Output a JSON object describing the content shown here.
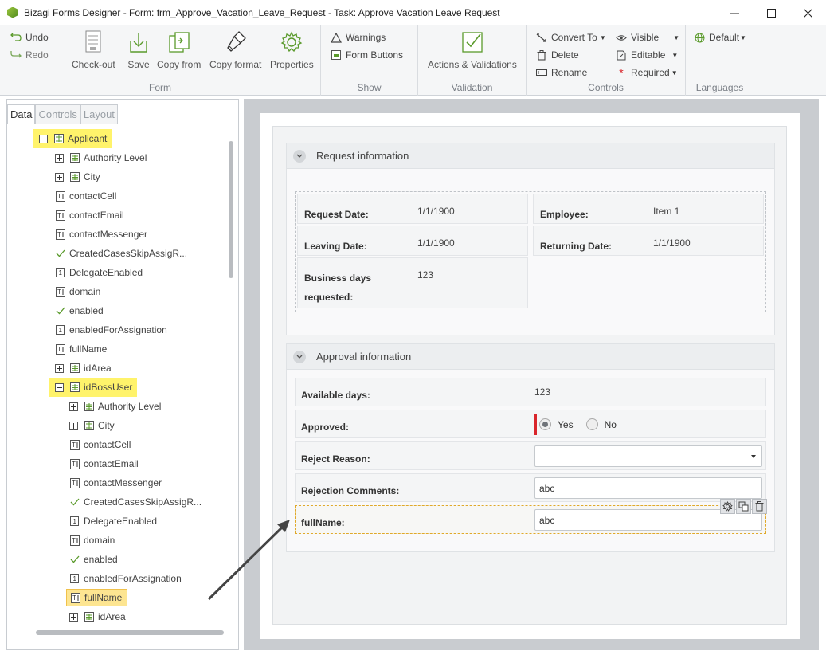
{
  "window": {
    "title": "Bizagi Forms Designer  - Form: frm_Approve_Vacation_Leave_Request - Task:  Approve Vacation Leave Request"
  },
  "ribbon": {
    "undo": "Undo",
    "redo": "Redo",
    "form": {
      "label": "Form",
      "checkout": "Check-out",
      "save": "Save",
      "copy_from": "Copy from",
      "copy_format": "Copy format",
      "properties": "Properties"
    },
    "show": {
      "label": "Show",
      "warnings": "Warnings",
      "form_buttons": "Form Buttons"
    },
    "validation": {
      "label": "Validation",
      "actions": "Actions & Validations"
    },
    "controls": {
      "label": "Controls",
      "convert_to": "Convert To",
      "delete": "Delete",
      "rename": "Rename",
      "visible": "Visible",
      "editable": "Editable",
      "required": "Required"
    },
    "languages": {
      "label": "Languages",
      "default": "Default"
    }
  },
  "left_panel": {
    "tabs": [
      "Data",
      "Controls",
      "Layout"
    ],
    "tree": [
      {
        "label": "Applicant",
        "icon": "entity-icon",
        "expander": "minus",
        "highlight": true
      },
      {
        "label": "Authority Level",
        "icon": "entity-icon",
        "expander": "plus"
      },
      {
        "label": "City",
        "icon": "entity-icon",
        "expander": "plus"
      },
      {
        "label": "contactCell",
        "icon": "text-attr-icon"
      },
      {
        "label": "contactEmail",
        "icon": "text-attr-icon"
      },
      {
        "label": "contactMessenger",
        "icon": "text-attr-icon"
      },
      {
        "label": "CreatedCasesSkipAssigR...",
        "icon": "check-icon"
      },
      {
        "label": "DelegateEnabled",
        "icon": "number-attr-icon"
      },
      {
        "label": "domain",
        "icon": "text-attr-icon"
      },
      {
        "label": "enabled",
        "icon": "check-icon"
      },
      {
        "label": "enabledForAssignation",
        "icon": "number-attr-icon"
      },
      {
        "label": "fullName",
        "icon": "text-attr-icon"
      },
      {
        "label": "idArea",
        "icon": "entity-icon",
        "expander": "plus"
      },
      {
        "label": "idBossUser",
        "icon": "entity-icon",
        "expander": "minus",
        "highlight": true
      },
      {
        "label": "Authority Level",
        "icon": "entity-icon",
        "expander": "plus"
      },
      {
        "label": "City",
        "icon": "entity-icon",
        "expander": "plus"
      },
      {
        "label": "contactCell",
        "icon": "text-attr-icon"
      },
      {
        "label": "contactEmail",
        "icon": "text-attr-icon"
      },
      {
        "label": "contactMessenger",
        "icon": "text-attr-icon"
      },
      {
        "label": "CreatedCasesSkipAssigR...",
        "icon": "check-icon"
      },
      {
        "label": "DelegateEnabled",
        "icon": "number-attr-icon"
      },
      {
        "label": "domain",
        "icon": "text-attr-icon"
      },
      {
        "label": "enabled",
        "icon": "check-icon"
      },
      {
        "label": "enabledForAssignation",
        "icon": "number-attr-icon"
      },
      {
        "label": "fullName",
        "icon": "text-attr-icon",
        "selected": true
      },
      {
        "label": "idArea",
        "icon": "entity-icon",
        "expander": "plus"
      }
    ]
  },
  "form": {
    "request_group": {
      "title": "Request information",
      "request_date_label": "Request Date:",
      "request_date_value": "1/1/1900",
      "employee_label": "Employee:",
      "employee_value": "Item 1",
      "leaving_date_label": "Leaving Date:",
      "leaving_date_value": "1/1/1900",
      "returning_date_label": "Returning Date:",
      "returning_date_value": "1/1/1900",
      "business_days_label_1": "Business days",
      "business_days_label_2": "requested:",
      "business_days_value": "123"
    },
    "approval_group": {
      "title": "Approval information",
      "available_days_label": "Available days:",
      "available_days_value": "123",
      "approved_label": "Approved:",
      "approved_yes": "Yes",
      "approved_no": "No",
      "reject_reason_label": "Reject Reason:",
      "rejection_comments_label": "Rejection Comments:",
      "rejection_comments_value": "abc",
      "fullname_label": "fullName:",
      "fullname_value": "abc"
    }
  },
  "colors": {
    "highlight": "#fff36b",
    "selected": "#fde591",
    "required": "#d9252b",
    "accent": "#5a9a2b"
  }
}
